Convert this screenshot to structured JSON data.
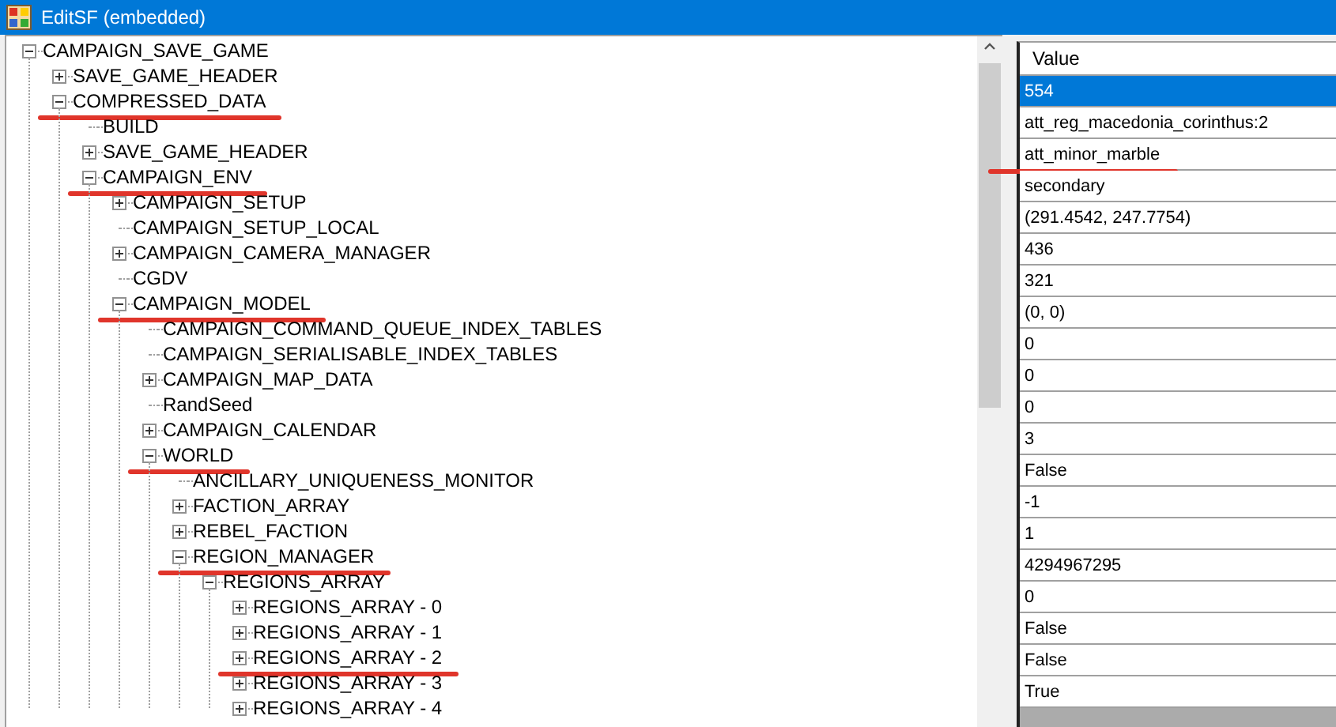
{
  "window": {
    "title": "EditSF (embedded)"
  },
  "tree": [
    {
      "label": "CAMPAIGN_SAVE_GAME",
      "kind": "node",
      "expanded": true,
      "marked": false,
      "children": [
        {
          "label": "SAVE_GAME_HEADER",
          "kind": "node",
          "expanded": false,
          "marked": false
        },
        {
          "label": "COMPRESSED_DATA",
          "kind": "node",
          "expanded": true,
          "marked": true,
          "children": [
            {
              "label": "BUILD",
              "kind": "leaf",
              "marked": false
            },
            {
              "label": "SAVE_GAME_HEADER",
              "kind": "node",
              "expanded": false,
              "marked": false
            },
            {
              "label": "CAMPAIGN_ENV",
              "kind": "node",
              "expanded": true,
              "marked": true,
              "children": [
                {
                  "label": "CAMPAIGN_SETUP",
                  "kind": "node",
                  "expanded": false,
                  "marked": false
                },
                {
                  "label": "CAMPAIGN_SETUP_LOCAL",
                  "kind": "leaf",
                  "marked": false
                },
                {
                  "label": "CAMPAIGN_CAMERA_MANAGER",
                  "kind": "node",
                  "expanded": false,
                  "marked": false
                },
                {
                  "label": "CGDV",
                  "kind": "leaf",
                  "marked": false
                },
                {
                  "label": "CAMPAIGN_MODEL",
                  "kind": "node",
                  "expanded": true,
                  "marked": true,
                  "children": [
                    {
                      "label": "CAMPAIGN_COMMAND_QUEUE_INDEX_TABLES",
                      "kind": "leaf",
                      "marked": false
                    },
                    {
                      "label": "CAMPAIGN_SERIALISABLE_INDEX_TABLES",
                      "kind": "leaf",
                      "marked": false
                    },
                    {
                      "label": "CAMPAIGN_MAP_DATA",
                      "kind": "node",
                      "expanded": false,
                      "marked": false
                    },
                    {
                      "label": "RandSeed",
                      "kind": "leaf",
                      "marked": false
                    },
                    {
                      "label": "CAMPAIGN_CALENDAR",
                      "kind": "node",
                      "expanded": false,
                      "marked": false
                    },
                    {
                      "label": "WORLD",
                      "kind": "node",
                      "expanded": true,
                      "marked": true,
                      "children": [
                        {
                          "label": "ANCILLARY_UNIQUENESS_MONITOR",
                          "kind": "leaf",
                          "marked": false
                        },
                        {
                          "label": "FACTION_ARRAY",
                          "kind": "node",
                          "expanded": false,
                          "marked": false
                        },
                        {
                          "label": "REBEL_FACTION",
                          "kind": "node",
                          "expanded": false,
                          "marked": false
                        },
                        {
                          "label": "REGION_MANAGER",
                          "kind": "node",
                          "expanded": true,
                          "marked": true,
                          "children": [
                            {
                              "label": "REGIONS_ARRAY",
                              "kind": "node",
                              "expanded": true,
                              "marked": false,
                              "children": [
                                {
                                  "label": "REGIONS_ARRAY - 0",
                                  "kind": "node",
                                  "expanded": false,
                                  "marked": false
                                },
                                {
                                  "label": "REGIONS_ARRAY - 1",
                                  "kind": "node",
                                  "expanded": false,
                                  "marked": false
                                },
                                {
                                  "label": "REGIONS_ARRAY - 2",
                                  "kind": "node",
                                  "expanded": false,
                                  "marked": true
                                },
                                {
                                  "label": "REGIONS_ARRAY - 3",
                                  "kind": "node",
                                  "expanded": false,
                                  "marked": false
                                },
                                {
                                  "label": "REGIONS_ARRAY - 4",
                                  "kind": "node",
                                  "expanded": false,
                                  "marked": false
                                }
                              ]
                            }
                          ]
                        }
                      ]
                    }
                  ]
                }
              ]
            }
          ]
        }
      ]
    }
  ],
  "grid": {
    "column": "Value",
    "rows": [
      {
        "value": "554",
        "selected": true,
        "marked": false
      },
      {
        "value": "att_reg_macedonia_corinthus:2",
        "selected": false,
        "marked": false
      },
      {
        "value": "att_minor_marble",
        "selected": false,
        "marked": true
      },
      {
        "value": "secondary",
        "selected": false,
        "marked": false
      },
      {
        "value": "(291.4542, 247.7754)",
        "selected": false,
        "marked": false
      },
      {
        "value": "436",
        "selected": false,
        "marked": false
      },
      {
        "value": "321",
        "selected": false,
        "marked": false
      },
      {
        "value": "(0, 0)",
        "selected": false,
        "marked": false
      },
      {
        "value": "0",
        "selected": false,
        "marked": false
      },
      {
        "value": "0",
        "selected": false,
        "marked": false
      },
      {
        "value": "0",
        "selected": false,
        "marked": false
      },
      {
        "value": "3",
        "selected": false,
        "marked": false
      },
      {
        "value": "False",
        "selected": false,
        "marked": false
      },
      {
        "value": "-1",
        "selected": false,
        "marked": false
      },
      {
        "value": "1",
        "selected": false,
        "marked": false
      },
      {
        "value": "4294967295",
        "selected": false,
        "marked": false
      },
      {
        "value": "0",
        "selected": false,
        "marked": false
      },
      {
        "value": "False",
        "selected": false,
        "marked": false
      },
      {
        "value": "False",
        "selected": false,
        "marked": false
      },
      {
        "value": "True",
        "selected": false,
        "marked": false
      }
    ]
  }
}
